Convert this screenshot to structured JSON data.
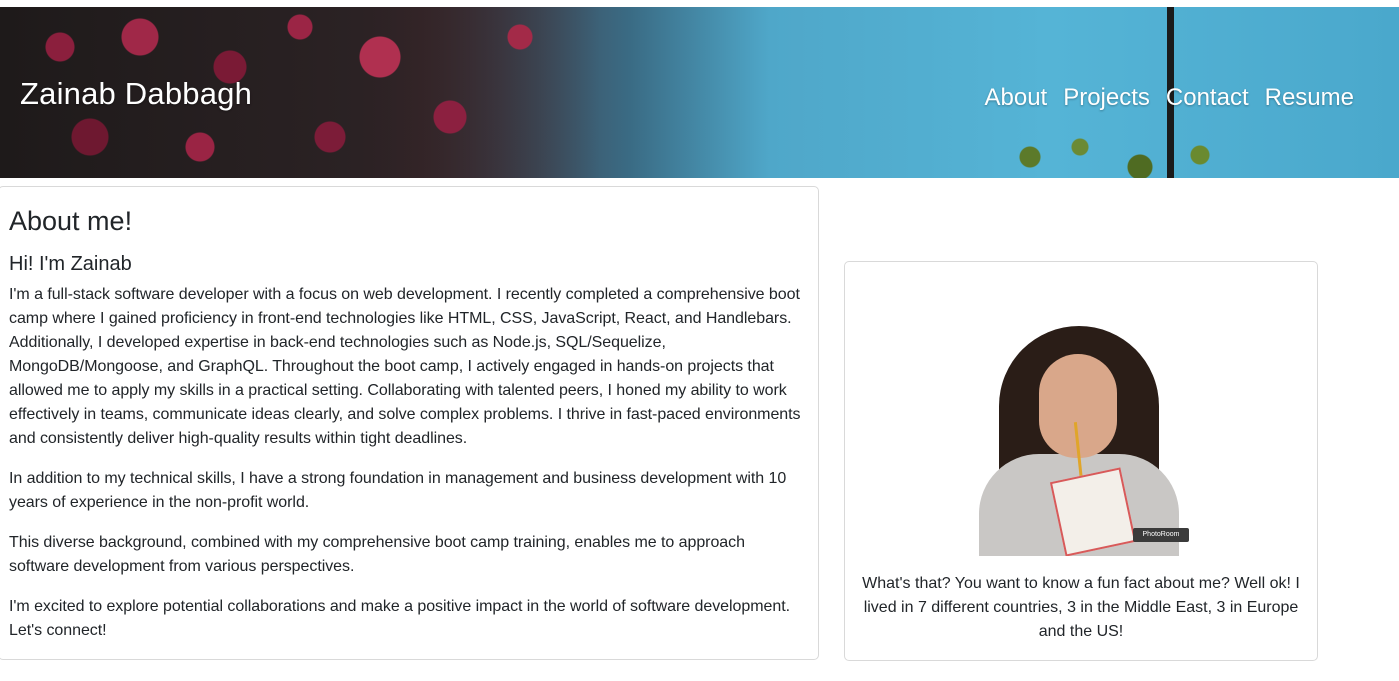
{
  "header": {
    "brand": "Zainab Dabbagh",
    "nav": [
      "About",
      "Projects",
      "Contact",
      "Resume"
    ]
  },
  "about": {
    "title": "About me!",
    "subtitle": "Hi! I'm Zainab",
    "paragraphs": [
      "I'm a full-stack software developer with a focus on web development. I recently completed a comprehensive boot camp where I gained proficiency in front-end technologies like HTML, CSS, JavaScript, React, and Handlebars. Additionally, I developed expertise in back-end technologies such as Node.js, SQL/Sequelize, MongoDB/Mongoose, and GraphQL. Throughout the boot camp, I actively engaged in hands-on projects that allowed me to apply my skills in a practical setting. Collaborating with talented peers, I honed my ability to work effectively in teams, communicate ideas clearly, and solve complex problems. I thrive in fast-paced environments and consistently deliver high-quality results within tight deadlines.",
      "In addition to my technical skills, I have a strong foundation in management and business development with 10 years of experience in the non-profit world.",
      "This diverse background, combined with my comprehensive boot camp training, enables me to approach software development from various perspectives.",
      "I'm excited to explore potential collaborations and make a positive impact in the world of software development. Let's connect!"
    ]
  },
  "photo": {
    "badge": "PhotoRoom",
    "caption": "What's that? You want to know a fun fact about me? Well ok! I lived in 7 different countries, 3 in the Middle East, 3 in Europe and the US!"
  }
}
